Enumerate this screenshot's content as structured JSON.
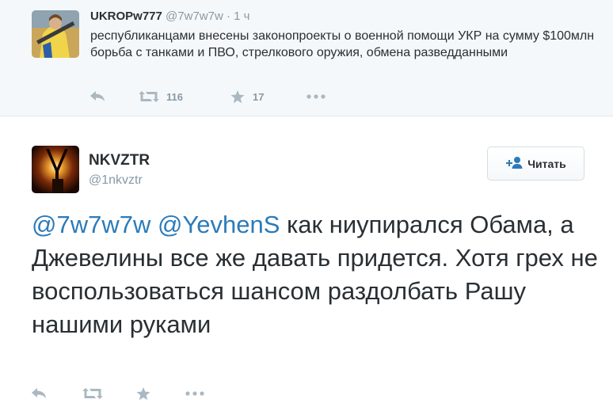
{
  "parent_tweet": {
    "name": "UKROPw777",
    "handle": "@7w7w7w",
    "dot": "·",
    "time": "1 ч",
    "text": "республиканцами внесены законопроекты о военной помощи УКР на сумму $100млн борьба с танками и ПВО, стрелкового оружия, обмена разведданными",
    "retweets": "116",
    "favorites": "17"
  },
  "main_tweet": {
    "name": "NKVZTR",
    "handle": "@1nkvztr",
    "follow_label": "Читать",
    "mention_1": "@7w7w7w",
    "mention_2": "@YevhenS",
    "body": "как ниупирался Обама, а Джевелины все же давать придется. Хотя грех не воспользоваться шансом раздолбать Рашу нашими руками"
  },
  "colors": {
    "mention": "#2b7bb9",
    "icon": "#aab8c2",
    "muted": "#8899a6",
    "parent_bg": "#f5f8fa"
  },
  "icons": [
    "reply-icon",
    "retweet-icon",
    "star-icon",
    "more-icon",
    "follow-person-icon"
  ]
}
